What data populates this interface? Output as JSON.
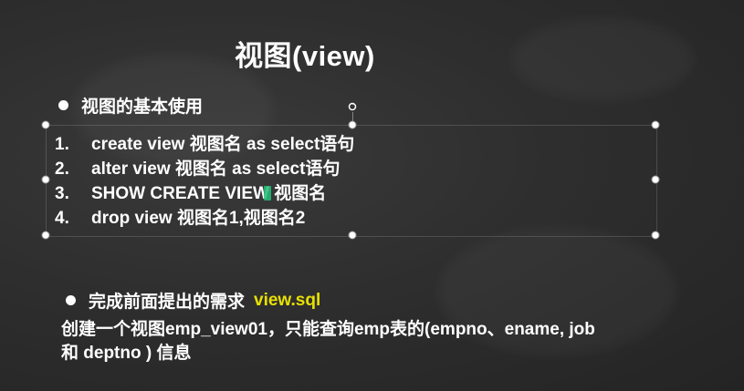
{
  "slide": {
    "title": "视图(view)",
    "section1": {
      "heading": "视图的基本使用",
      "items": [
        {
          "num": "1.",
          "text": "create view 视图名 as select语句"
        },
        {
          "num": "2.",
          "text": "alter view 视图名 as select语句"
        },
        {
          "num": "3.",
          "text": "SHOW CREATE VIEW  视图名"
        },
        {
          "num": "4.",
          "text": "drop view 视图名1,视图名2"
        }
      ]
    },
    "section2": {
      "heading": "完成前面提出的需求",
      "highlight": "view.sql",
      "line1": "创建一个视图emp_view01，只能查询emp表的(empno、ename, job",
      "line2": "和 deptno ) 信息"
    }
  },
  "colors": {
    "background": "#2e2e2e",
    "text": "#ffffff",
    "highlight": "#e8e000",
    "cursor": "#25c07a"
  }
}
